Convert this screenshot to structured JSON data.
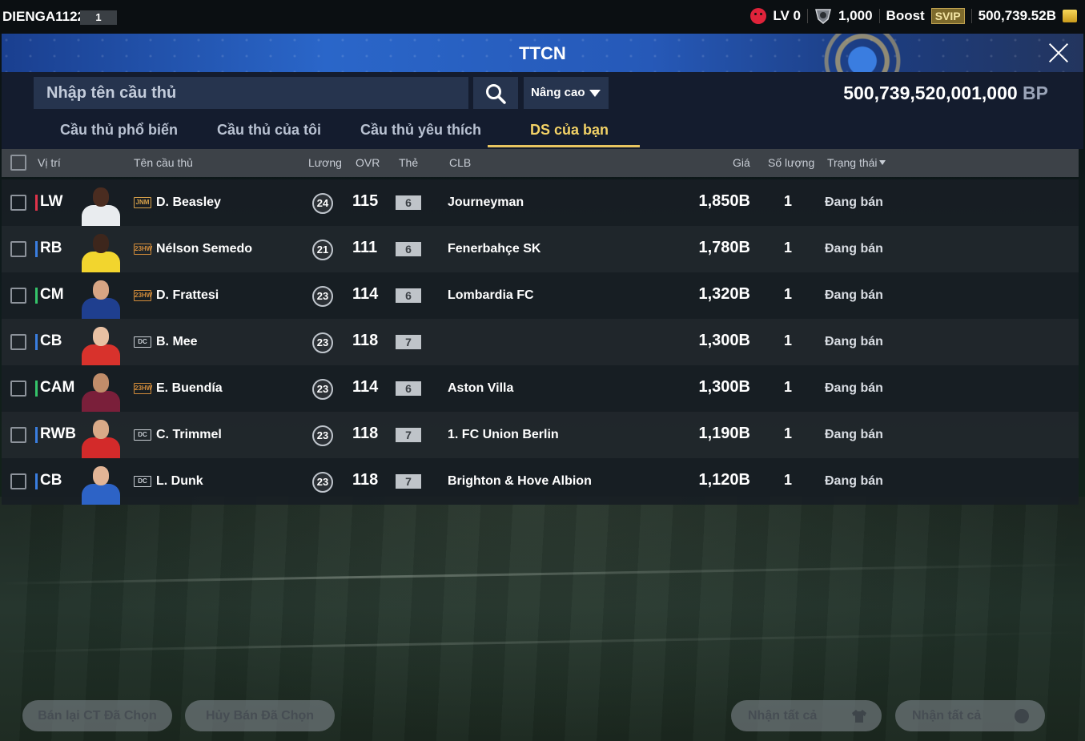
{
  "topbar": {
    "username": "DIENGA1122",
    "user_level": "1",
    "lv": "LV 0",
    "points": "1,000",
    "boost_label": "Boost",
    "svip_label": "SVIP",
    "coins": "500,739.52B",
    "icons": [
      "sad-face-icon",
      "shield-icon",
      "coin-icon"
    ]
  },
  "header": {
    "title": "TTCN"
  },
  "search": {
    "placeholder": "Nhập tên cầu thủ",
    "advanced_label": "Nâng cao",
    "bp_value": "500,739,520,001,000",
    "bp_unit": "BP"
  },
  "tabs": [
    {
      "label": "Cầu thủ phổ biến",
      "active": false
    },
    {
      "label": "Cầu thủ của tôi",
      "active": false
    },
    {
      "label": "Cầu thủ yêu thích",
      "active": false
    },
    {
      "label": "DS của bạn",
      "active": true
    }
  ],
  "table": {
    "columns": {
      "position": "Vị trí",
      "name": "Tên cầu thủ",
      "salary": "Lương",
      "ovr": "OVR",
      "grade": "Thẻ",
      "club": "CLB",
      "price": "Giá",
      "qty": "Số lượng",
      "status": "Trạng thái"
    },
    "rows": [
      {
        "position": "LW",
        "pos_color": "#e0334a",
        "season": "JNM",
        "season_color": "#d9a24a",
        "name": "D. Beasley",
        "salary": "24",
        "ovr": "115",
        "grade": "6",
        "club": "Journeyman",
        "price": "1,850B",
        "qty": "1",
        "status": "Đang bán",
        "kit": "#e9ecef",
        "skin": "#4a2c20"
      },
      {
        "position": "RB",
        "pos_color": "#3a7ee0",
        "season": "23HW",
        "season_color": "#d28c3a",
        "name": "Nélson Semedo",
        "salary": "21",
        "ovr": "111",
        "grade": "6",
        "club": "Fenerbahçe SK",
        "price": "1,780B",
        "qty": "1",
        "status": "Đang bán",
        "kit": "#f2d52e",
        "skin": "#3d261c"
      },
      {
        "position": "CM",
        "pos_color": "#35c46a",
        "season": "23HW",
        "season_color": "#d28c3a",
        "name": "D. Frattesi",
        "salary": "23",
        "ovr": "114",
        "grade": "6",
        "club": "Lombardia FC",
        "price": "1,320B",
        "qty": "1",
        "status": "Đang bán",
        "kit": "#1f3f8f",
        "skin": "#d7a584"
      },
      {
        "position": "CB",
        "pos_color": "#3a7ee0",
        "season": "DC",
        "season_color": "#c9ced4",
        "name": "B. Mee",
        "salary": "23",
        "ovr": "118",
        "grade": "7",
        "club": "",
        "price": "1,300B",
        "qty": "1",
        "status": "Đang bán",
        "kit": "#d8322c",
        "skin": "#e9c1a3"
      },
      {
        "position": "CAM",
        "pos_color": "#35c46a",
        "season": "23HW",
        "season_color": "#d28c3a",
        "name": "E. Buendía",
        "salary": "23",
        "ovr": "114",
        "grade": "6",
        "club": "Aston Villa",
        "price": "1,300B",
        "qty": "1",
        "status": "Đang bán",
        "kit": "#7a1f3a",
        "skin": "#c08d6a"
      },
      {
        "position": "RWB",
        "pos_color": "#3a7ee0",
        "season": "DC",
        "season_color": "#c9ced4",
        "name": "C. Trimmel",
        "salary": "23",
        "ovr": "118",
        "grade": "7",
        "club": "1. FC Union Berlin",
        "price": "1,190B",
        "qty": "1",
        "status": "Đang bán",
        "kit": "#d32a2a",
        "skin": "#d9aa88"
      },
      {
        "position": "CB",
        "pos_color": "#3a7ee0",
        "season": "DC",
        "season_color": "#c9ced4",
        "name": "L. Dunk",
        "salary": "23",
        "ovr": "118",
        "grade": "7",
        "club": "Brighton & Hove Albion",
        "price": "1,120B",
        "qty": "1",
        "status": "Đang bán",
        "kit": "#2d63c6",
        "skin": "#e2b596"
      }
    ]
  },
  "bottom": {
    "resell_label": "Bán lại CT Đã Chọn",
    "cancel_label": "Hủy Bán Đã Chọn",
    "claim_all_label_1": "Nhận tất cả",
    "claim_all_label_2": "Nhận tất cả"
  }
}
